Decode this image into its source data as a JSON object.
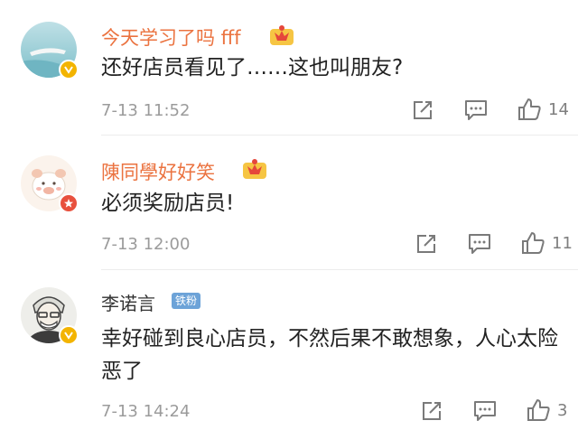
{
  "comments": [
    {
      "username": "今天学习了吗 fff",
      "text": "还好店员看见了……这也叫朋友?",
      "time": "7-13 11:52",
      "likes": "14"
    },
    {
      "username": "陳同學好好笑",
      "text": "必须奖励店员!",
      "time": "7-13 12:00",
      "likes": "11"
    },
    {
      "username": "李诺言",
      "fan_badge": "铁粉",
      "text": "幸好碰到良心店员，不然后果不敢想象，人心太险恶了",
      "time": "7-13 14:24",
      "likes": "3"
    }
  ],
  "colors": {
    "vip_name": "#eb7340",
    "badge_yellow": "#f3b400",
    "badge_red": "#e8503d",
    "fan_badge": "#6da3d8"
  }
}
